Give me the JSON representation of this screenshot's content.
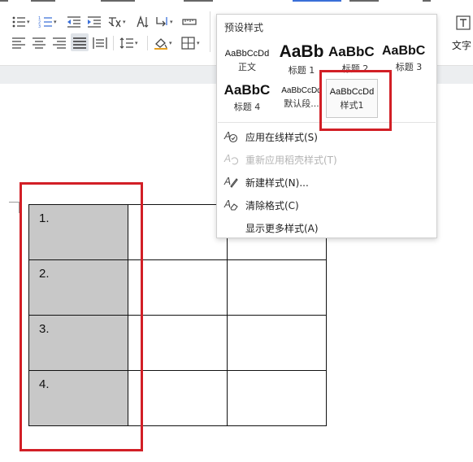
{
  "ribbon": {
    "text_tool_label": "文字",
    "colors": {
      "accent": "#3a6fd8",
      "icon": "#444444",
      "ribbon_bottom": "#eceef0"
    }
  },
  "styles_panel": {
    "title": "预设样式",
    "styles": [
      {
        "preview": "AaBbCcDd",
        "label": "正文",
        "kind": "normal"
      },
      {
        "preview": "AaBb",
        "label": "标题 1",
        "kind": "h1"
      },
      {
        "preview": "AaBbC",
        "label": "标题 2",
        "kind": "h2"
      },
      {
        "preview": "AaBbC",
        "label": "标题 3",
        "kind": "h3"
      },
      {
        "preview": "AaBbC",
        "label": "标题 4",
        "kind": "h4"
      },
      {
        "preview": "AaBbCcDd",
        "label": "默认段...",
        "kind": "normal"
      },
      {
        "preview": "AaBbCcDd",
        "label": "样式1",
        "kind": "custom",
        "selected": true
      }
    ],
    "menu": [
      {
        "label": "应用在线样式(S)",
        "icon": "online-style-icon",
        "enabled": true
      },
      {
        "label": "重新应用稻壳样式(T)",
        "icon": "reapply-style-icon",
        "enabled": false
      },
      {
        "label": "新建样式(N)...",
        "icon": "new-style-icon",
        "enabled": true
      },
      {
        "label": "清除格式(C)",
        "icon": "clear-format-icon",
        "enabled": true
      },
      {
        "label": "显示更多样式(A)",
        "icon": "",
        "enabled": true
      }
    ]
  },
  "document": {
    "table": {
      "rows": [
        [
          "1.",
          "",
          ""
        ],
        [
          "2.",
          "",
          ""
        ],
        [
          "3.",
          "",
          ""
        ],
        [
          "4.",
          "",
          ""
        ]
      ],
      "numbered_column_fill": "#c8c8c8"
    },
    "highlight_color": "#d21f26"
  }
}
